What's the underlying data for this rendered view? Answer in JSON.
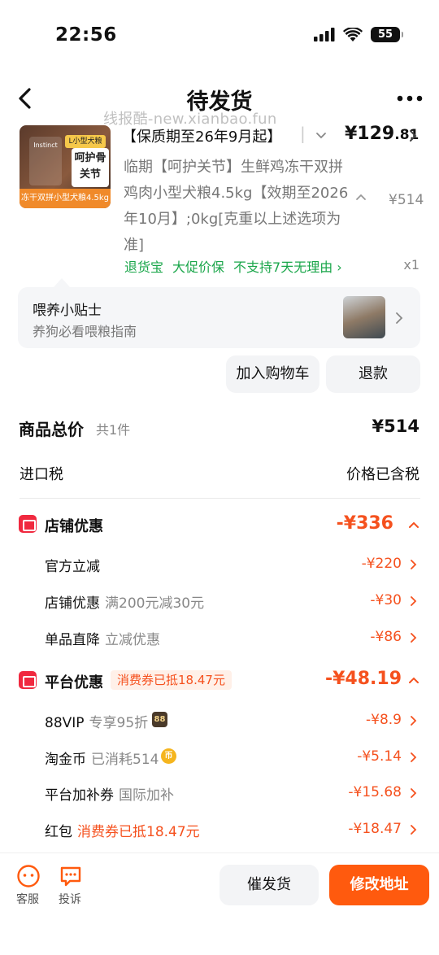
{
  "status_bar": {
    "time": "22:56",
    "battery": "55"
  },
  "nav": {
    "title": "待发货"
  },
  "watermark": "线报酷-new.xianbao.fun",
  "product": {
    "image": {
      "tag_small": "L小型犬粮",
      "tag_text": "呵护骨关节",
      "bottom_text": "冻干双拼小型犬粮4.5kg",
      "brand": "Instinct"
    },
    "spec": "【保质期至26年9月起】",
    "price_int": "¥129",
    "price_dec": ".81",
    "description": "临期【呵护关节】生鲜鸡冻干双拼鸡肉小型犬粮4.5kg【效期至2026年10月】;0kg[克重以上述选项为准]",
    "desc_price": "¥514",
    "services": [
      "退货宝",
      "大促价保",
      "不支持7天无理由 ›"
    ],
    "quantity": "x1"
  },
  "tips": {
    "title": "喂养小贴士",
    "subtitle": "养狗必看喂粮指南"
  },
  "actions": {
    "add_cart": "加入购物车",
    "refund": "退款"
  },
  "summary": {
    "total_label": "商品总价",
    "total_count": "共1件",
    "total_value": "¥514",
    "tax_label": "进口税",
    "tax_value": "价格已含税"
  },
  "store_discount": {
    "label": "店铺优惠",
    "value": "-¥336",
    "rows": [
      {
        "label": "官方立减",
        "sub": "",
        "value": "-¥220"
      },
      {
        "label": "店铺优惠",
        "sub": "满200元减30元",
        "value": "-¥30"
      },
      {
        "label": "单品直降",
        "sub": "立减优惠",
        "value": "-¥86"
      }
    ]
  },
  "platform_discount": {
    "label": "平台优惠",
    "badge": "消费券已抵18.47元",
    "value": "-¥48.19",
    "rows": [
      {
        "label": "88VIP",
        "sub": "专享95折",
        "badge": "88",
        "value": "-¥8.9"
      },
      {
        "label": "淘金币",
        "sub": "已消耗514",
        "badge": "币",
        "value": "-¥5.14"
      },
      {
        "label": "平台加补券",
        "sub": "国际加补",
        "value": "-¥15.68"
      },
      {
        "label": "红包",
        "sub": "消费券已抵18.47元",
        "value": "-¥18.47"
      }
    ]
  },
  "bottom": {
    "service": "客服",
    "complaint": "投诉",
    "urge": "催发货",
    "modify_address": "修改地址"
  },
  "colors": {
    "accent": "#ff5a0e",
    "discount": "#f5511e",
    "service_green": "#1aa64a",
    "section_icon": "#f0293f"
  }
}
